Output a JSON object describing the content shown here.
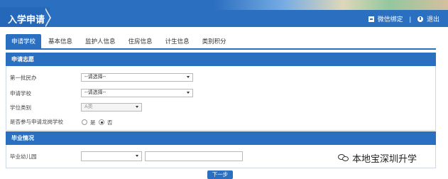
{
  "header": {
    "title": "入学申请",
    "wechat_bind": "微信绑定",
    "separator": "|",
    "logout": "退出"
  },
  "tabs": [
    {
      "label": "申请学校",
      "active": true
    },
    {
      "label": "基本信息",
      "active": false
    },
    {
      "label": "监护人信息",
      "active": false
    },
    {
      "label": "住房信息",
      "active": false
    },
    {
      "label": "计生信息",
      "active": false
    },
    {
      "label": "类别积分",
      "active": false
    }
  ],
  "section1": {
    "title": "申请志愿",
    "first_batch_label": "第一批民办",
    "first_batch_value": "--请选择--",
    "school_label": "申请学校",
    "school_value": "--请选择--",
    "degree_label": "学位类别",
    "degree_value": "A类",
    "lottery_label": "是否参与申请龙岗学校",
    "yes_label": "是",
    "no_label": "否",
    "selected": "否"
  },
  "section2": {
    "title": "毕业情况",
    "kindergarten_label": "毕业幼儿园",
    "kindergarten_select_value": "",
    "kindergarten_text_value": ""
  },
  "footer": {
    "next_label": "下一步"
  },
  "watermark": {
    "text": "本地宝深圳升学"
  },
  "colors": {
    "primary": "#2b6fc0"
  }
}
